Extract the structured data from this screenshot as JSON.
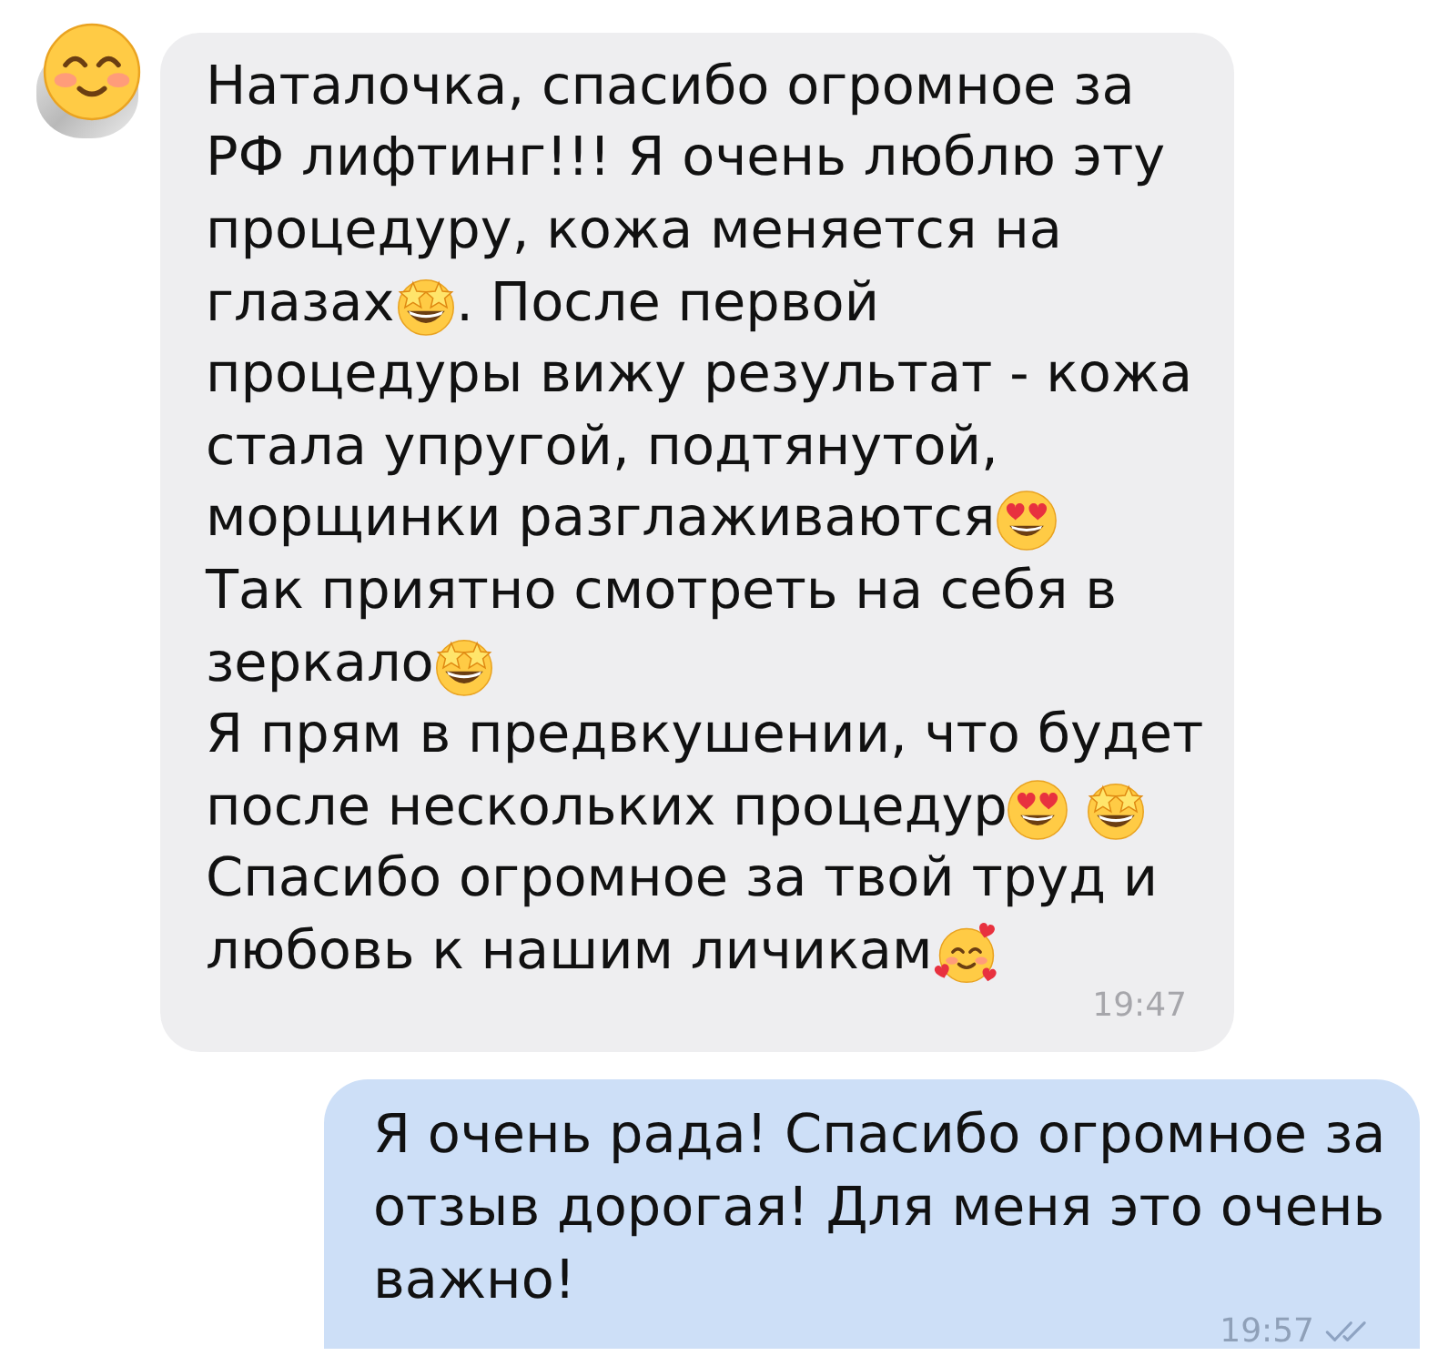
{
  "messages": [
    {
      "kind": "incoming",
      "lines": [
        [
          {
            "kind": "text",
            "text": "Наталочка, спасибо огромное за"
          }
        ],
        [
          {
            "kind": "text",
            "text": "РФ лифтинг!!! Я очень люблю эту"
          }
        ],
        [
          {
            "kind": "text",
            "text": "процедуру, кожа меняется на"
          }
        ],
        [
          {
            "kind": "text",
            "text": "глазах"
          },
          {
            "kind": "starstruck"
          },
          {
            "kind": "text",
            "text": ". После первой"
          }
        ],
        [
          {
            "kind": "text",
            "text": "процедуры вижу результат - кожа"
          }
        ],
        [
          {
            "kind": "text",
            "text": "стала упругой, подтянутой,"
          }
        ],
        [
          {
            "kind": "text",
            "text": "морщинки разглаживаются"
          },
          {
            "kind": "hearteyes"
          }
        ],
        [
          {
            "kind": "text",
            "text": "Так приятно смотреть на себя в"
          }
        ],
        [
          {
            "kind": "text",
            "text": "зеркало"
          },
          {
            "kind": "starstruck"
          }
        ],
        [
          {
            "kind": "text",
            "text": "Я прям в предвкушении, что будет"
          }
        ],
        [
          {
            "kind": "text",
            "text": "после нескольких процедур"
          },
          {
            "kind": "hearteyes"
          },
          {
            "kind": "starstruck"
          }
        ],
        [
          {
            "kind": "text",
            "text": "Спасибо огромное за твой труд и"
          }
        ],
        [
          {
            "kind": "text",
            "text": "любовь к нашим личикам"
          },
          {
            "kind": "hearts"
          }
        ]
      ],
      "time": "19:47"
    },
    {
      "kind": "outgoing",
      "text": "Я очень рада! Спасибо огромное за отзыв дорогая! Для меня это очень важно!",
      "time": "19:57",
      "read": true
    }
  ]
}
